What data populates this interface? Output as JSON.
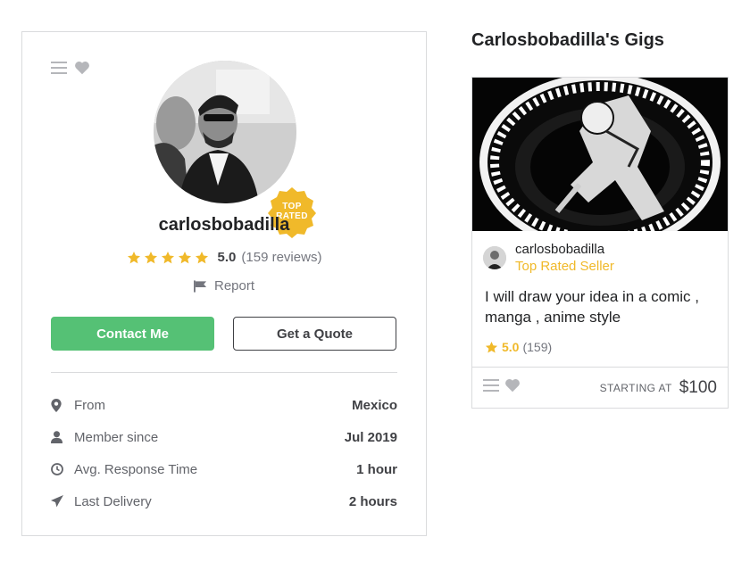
{
  "colors": {
    "brand_green": "#55c175",
    "star_yellow": "#f0b92a",
    "badge_yellow": "#f0b92a",
    "border": "#dadbdd",
    "text_dark": "#222325",
    "text_muted": "#74767e"
  },
  "profile": {
    "action_icons": [
      "list-icon",
      "heart-icon"
    ],
    "badge_text": "TOP RATED",
    "badge_line1": "TOP",
    "badge_line2": "RATED",
    "username": "carlosbobadilla",
    "rating": {
      "stars": 5,
      "score": "5.0",
      "count": "(159 reviews)"
    },
    "report_label": "Report",
    "buttons": {
      "contact": "Contact Me",
      "quote": "Get a Quote"
    },
    "stats": [
      {
        "icon": "location-pin-icon",
        "label": "From",
        "value": "Mexico"
      },
      {
        "icon": "user-icon",
        "label": "Member since",
        "value": "Jul 2019"
      },
      {
        "icon": "clock-icon",
        "label": "Avg. Response Time",
        "value": "1 hour"
      },
      {
        "icon": "paper-plane-icon",
        "label": "Last Delivery",
        "value": "2 hours"
      }
    ]
  },
  "gigs": {
    "title": "Carlosbobadilla's Gigs",
    "items": [
      {
        "seller_name": "carlosbobadilla",
        "seller_level": "Top Rated Seller",
        "description": "I will draw your idea in a comic , manga , anime style",
        "rating_score": "5.0",
        "rating_count": "(159)",
        "price_label": "STARTING AT",
        "price": "$100"
      }
    ]
  }
}
